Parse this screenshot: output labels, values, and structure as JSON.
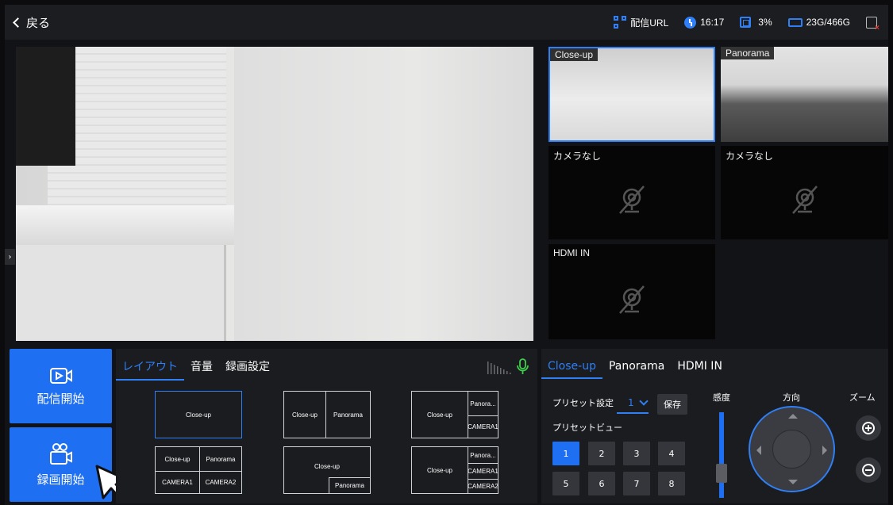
{
  "topbar": {
    "back_label": "戻る",
    "stream_url_label": "配信URL",
    "time": "16:17",
    "cpu": "3%",
    "storage": "23G/466G"
  },
  "cameras": [
    {
      "label": "Close-up",
      "state": "live"
    },
    {
      "label": "Panorama",
      "state": "live"
    },
    {
      "label": "カメラなし",
      "state": "none"
    },
    {
      "label": "カメラなし",
      "state": "none"
    },
    {
      "label": "HDMI IN",
      "state": "none"
    }
  ],
  "actions": {
    "stream_start": "配信開始",
    "record_start": "録画開始"
  },
  "layout_panel": {
    "tabs": [
      "レイアウト",
      "音量",
      "録画設定"
    ],
    "active_tab": 0,
    "options": {
      "single": [
        "Close-up"
      ],
      "two": [
        "Close-up",
        "Panorama"
      ],
      "three_right": [
        "Close-up",
        "Panora...",
        "CAMERA1"
      ],
      "quad": [
        "Close-up",
        "Panorama",
        "CAMERA1",
        "CAMERA2"
      ],
      "pip": [
        "Close-up",
        "Panorama"
      ],
      "four_right": [
        "Close-up",
        "Panora...",
        "CAMERA1",
        "CAMERA2"
      ]
    }
  },
  "ptz_panel": {
    "tabs": [
      "Close-up",
      "Panorama",
      "HDMI IN"
    ],
    "active_tab": 0,
    "preset_setting_label": "プリセット設定",
    "preset_value": "1",
    "save_label": "保存",
    "preset_view_label": "プリセットビュー",
    "presets": [
      "1",
      "2",
      "3",
      "4",
      "5",
      "6",
      "7",
      "8"
    ],
    "active_preset": "1",
    "sensitivity_label": "感度",
    "direction_label": "方向",
    "zoom_label": "ズーム"
  },
  "colors": {
    "accent": "#2f7ff6",
    "button": "#1f6ff2",
    "panel": "#1b1c20",
    "mic": "#3ecf4c"
  }
}
